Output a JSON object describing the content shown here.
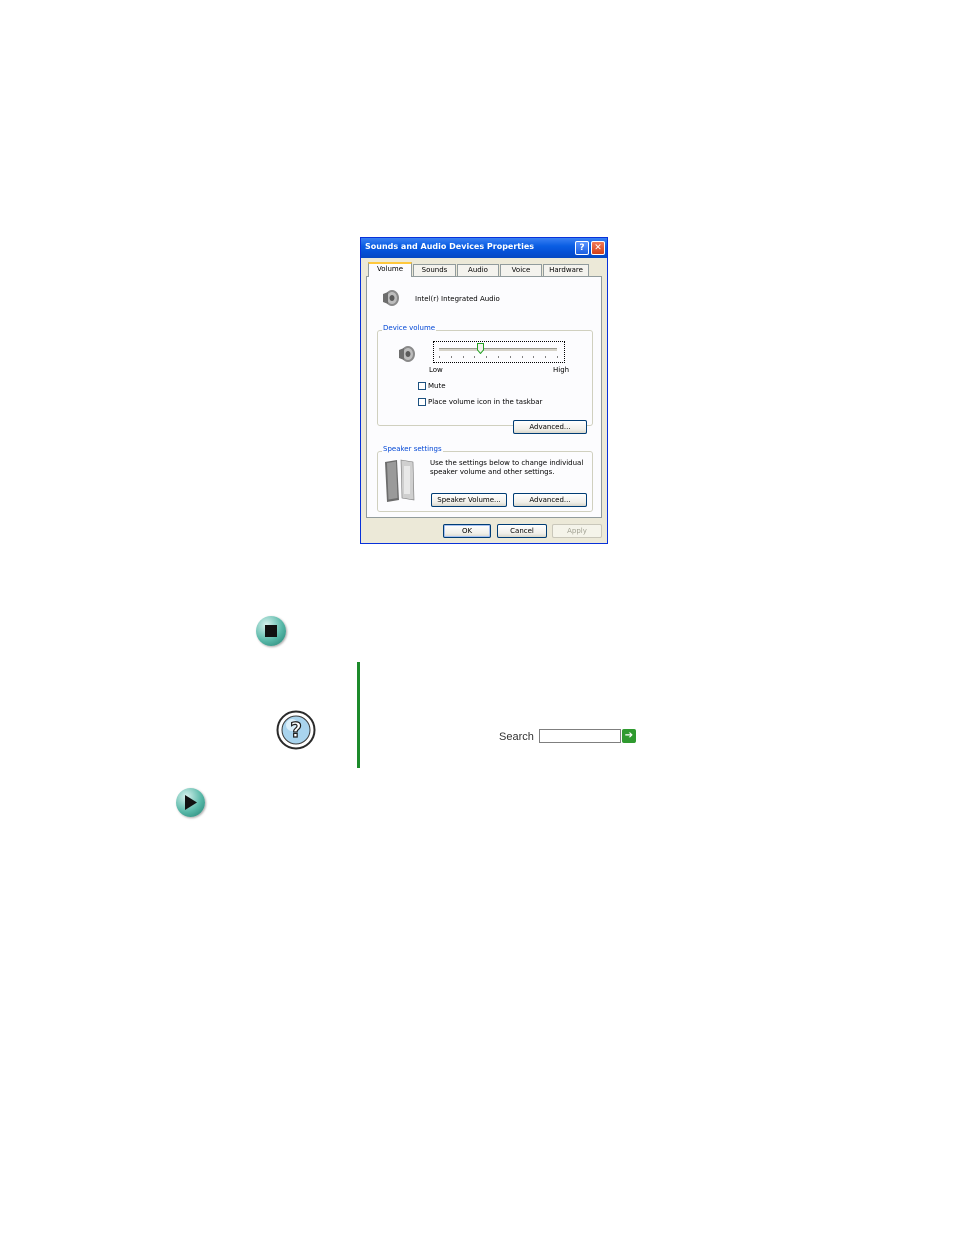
{
  "dialog": {
    "title": "Sounds and Audio Devices Properties",
    "help_label": "?",
    "close_label": "✕",
    "tabs": [
      {
        "label": "Volume"
      },
      {
        "label": "Sounds"
      },
      {
        "label": "Audio"
      },
      {
        "label": "Voice"
      },
      {
        "label": "Hardware"
      }
    ],
    "active_tab": "Volume",
    "device_name": "Intel(r) Integrated Audio",
    "device_volume": {
      "group_title": "Device volume",
      "low_label": "Low",
      "high_label": "High",
      "level_fraction": 0.35,
      "tick_count": 10,
      "mute_label": "Mute",
      "mute_checked": false,
      "taskbar_label": "Place volume icon in the taskbar",
      "taskbar_checked": false,
      "advanced_label": "Advanced..."
    },
    "speaker_settings": {
      "group_title": "Speaker settings",
      "description_line1": "Use the settings below to change individual",
      "description_line2": "speaker volume and other settings.",
      "speaker_volume_label": "Speaker Volume...",
      "advanced_label": "Advanced..."
    },
    "footer": {
      "ok_label": "OK",
      "cancel_label": "Cancel",
      "apply_label": "Apply"
    }
  },
  "page": {
    "help_icon_glyph": "?",
    "search_label": "Search",
    "search_value": "",
    "go_glyph": "➔"
  },
  "icons": {
    "stop": "stop-icon",
    "help": "help-icon",
    "next": "play-arrow-icon",
    "speaker": "speaker-icon",
    "speakers": "desktop-speakers-icon"
  },
  "colors": {
    "titlebar": "#0a5ee3",
    "group_title": "#0046d5",
    "accent_bar": "#1c8a2a",
    "round_icon": "#58b8a8"
  }
}
